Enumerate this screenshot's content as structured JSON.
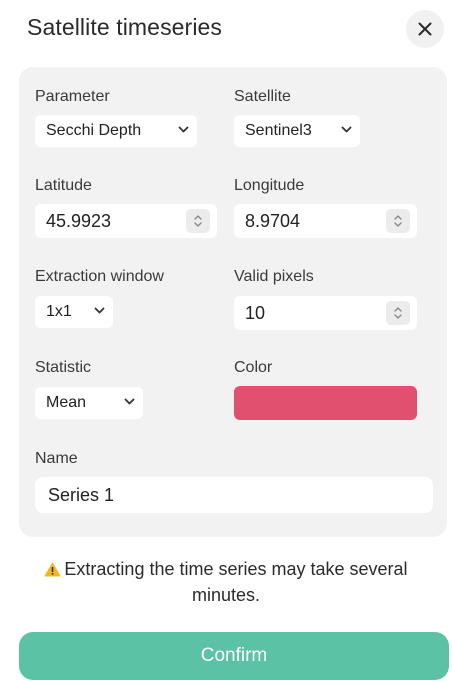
{
  "dialog": {
    "title": "Satellite timeseries",
    "close_icon": "close-icon"
  },
  "form": {
    "parameter": {
      "label": "Parameter",
      "value": "Secchi Depth"
    },
    "satellite": {
      "label": "Satellite",
      "value": "Sentinel3"
    },
    "latitude": {
      "label": "Latitude",
      "value": "45.9923"
    },
    "longitude": {
      "label": "Longitude",
      "value": "8.9704"
    },
    "extraction_window": {
      "label": "Extraction window",
      "value": "1x1"
    },
    "valid_pixels": {
      "label": "Valid pixels",
      "value": "10"
    },
    "statistic": {
      "label": "Statistic",
      "value": "Mean"
    },
    "color": {
      "label": "Color",
      "value": "#e2506f"
    },
    "name": {
      "label": "Name",
      "value": "Series 1"
    }
  },
  "warning": {
    "icon": "warning-icon",
    "text": "Extracting the time series may take several minutes."
  },
  "actions": {
    "confirm_label": "Confirm"
  },
  "colors": {
    "accent": "#5cc2a6",
    "panel": "#f2f2f2",
    "warning": "#f2b824"
  }
}
